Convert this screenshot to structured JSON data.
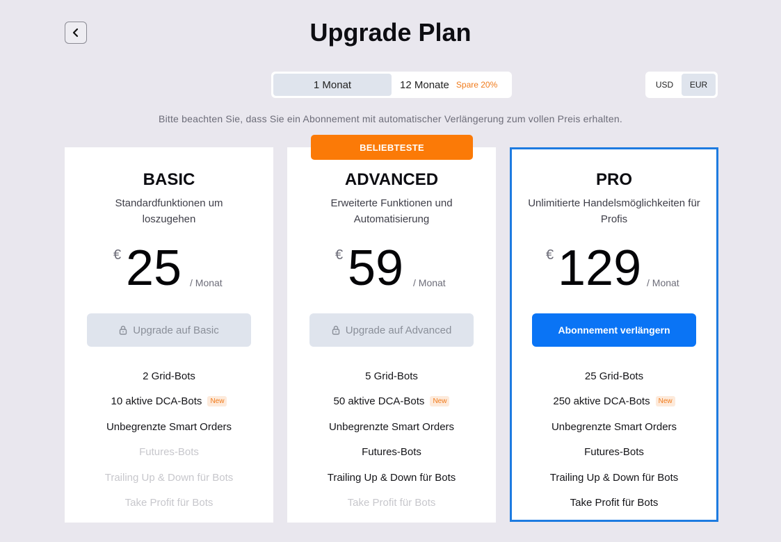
{
  "header": {
    "title": "Upgrade Plan"
  },
  "period": {
    "monthly_label": "1 Monat",
    "yearly_label": "12 Monate",
    "yearly_save": "Spare 20%",
    "selected": "monthly"
  },
  "currency": {
    "usd": "USD",
    "eur": "EUR",
    "selected": "EUR"
  },
  "notice": "Bitte beachten Sie, dass Sie ein Abonnement mit automatischer Verlängerung zum vollen Preis erhalten.",
  "badge": "BELIEBTESTE",
  "new_tag": "New",
  "colors": {
    "accent": "#0a74f5",
    "badge": "#fb7a07",
    "pro_border": "#1d7be0",
    "save": "#f07a1a"
  },
  "plans": [
    {
      "name": "BASIC",
      "desc": "Standardfunktionen um loszugehen",
      "currency_symbol": "€",
      "price": "25",
      "per": "/ Monat",
      "cta": "Upgrade auf Basic",
      "features": [
        "2 Grid-Bots",
        "10 aktive DCA-Bots",
        "Unbegrenzte Smart Orders",
        "Futures-Bots",
        "Trailing Up & Down für Bots",
        "Take Profit für Bots"
      ]
    },
    {
      "name": "ADVANCED",
      "desc": "Erweiterte Funktionen und Automatisierung",
      "currency_symbol": "€",
      "price": "59",
      "per": "/ Monat",
      "cta": "Upgrade auf Advanced",
      "features": [
        "5 Grid-Bots",
        "50 aktive DCA-Bots",
        "Unbegrenzte Smart Orders",
        "Futures-Bots",
        "Trailing Up & Down für Bots",
        "Take Profit für Bots"
      ]
    },
    {
      "name": "PRO",
      "desc": "Unlimitierte Handelsmöglichkeiten für Profis",
      "currency_symbol": "€",
      "price": "129",
      "per": "/ Monat",
      "cta": "Abonnement verlängern",
      "features": [
        "25 Grid-Bots",
        "250 aktive DCA-Bots",
        "Unbegrenzte Smart Orders",
        "Futures-Bots",
        "Trailing Up & Down für Bots",
        "Take Profit für Bots"
      ]
    }
  ]
}
